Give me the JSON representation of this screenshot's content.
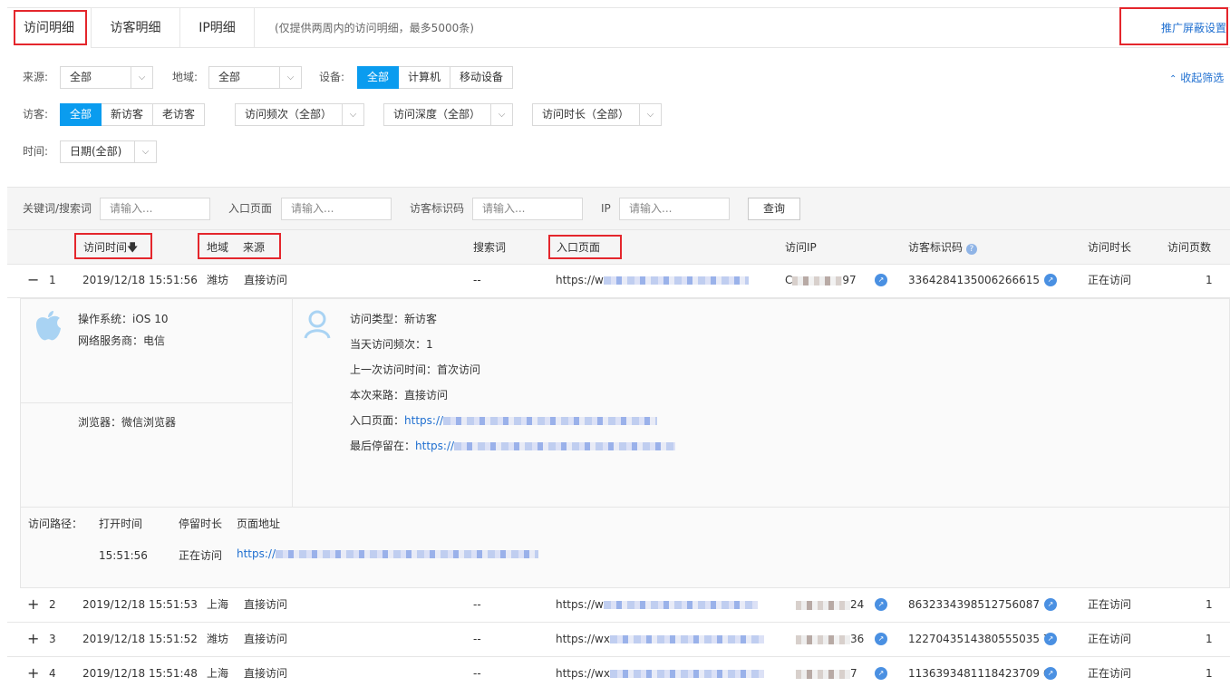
{
  "tabs": [
    {
      "label": "访问明细"
    },
    {
      "label": "访客明细"
    },
    {
      "label": "IP明细"
    }
  ],
  "tab_hint": "(仅提供两周内的访问明细，最多5000条)",
  "promo_link": "推广屏蔽设置",
  "collapse_filter": "收起筛选",
  "filters": {
    "source_label": "来源:",
    "source_value": "全部",
    "region_label": "地域:",
    "region_value": "全部",
    "device_label": "设备:",
    "device_options": [
      "全部",
      "计算机",
      "移动设备"
    ],
    "visitor_label": "访客:",
    "visitor_options": [
      "全部",
      "新访客",
      "老访客"
    ],
    "freq_value": "访问频次（全部）",
    "depth_value": "访问深度（全部）",
    "duration_value": "访问时长（全部）",
    "time_label": "时间:",
    "time_value": "日期(全部)"
  },
  "search": {
    "keyword_label": "关键词/搜索词",
    "entry_label": "入口页面",
    "visitor_id_label": "访客标识码",
    "ip_label": "IP",
    "placeholder": "请输入...",
    "query_button": "查询"
  },
  "columns": {
    "visit_time": "访问时间",
    "region": "地域",
    "source": "来源",
    "search_word": "搜索词",
    "entry_page": "入口页面",
    "visitor_ip": "访问IP",
    "visitor_id": "访客标识码",
    "duration": "访问时长",
    "pages": "访问页数"
  },
  "rows": [
    {
      "toggle": "−",
      "index": "1",
      "time": "2019/12/18 15:51:56",
      "region": "潍坊",
      "source": "直接访问",
      "search": "--",
      "entry": "https://w",
      "ip_tail": "97",
      "ip_head": "C",
      "vid": "3364284135006266615",
      "duration": "正在访问",
      "pages": "1"
    },
    {
      "toggle": "+",
      "index": "2",
      "time": "2019/12/18 15:51:53",
      "region": "上海",
      "source": "直接访问",
      "search": "--",
      "entry": "https://w",
      "ip_tail": "24",
      "ip_head": "",
      "vid": "8632334398512756087",
      "duration": "正在访问",
      "pages": "1"
    },
    {
      "toggle": "+",
      "index": "3",
      "time": "2019/12/18 15:51:52",
      "region": "潍坊",
      "source": "直接访问",
      "search": "--",
      "entry": "https://wx",
      "ip_tail": "36",
      "ip_head": "",
      "vid": "1227043514380555035 7",
      "duration": "正在访问",
      "pages": "1"
    },
    {
      "toggle": "+",
      "index": "4",
      "time": "2019/12/18 15:51:48",
      "region": "上海",
      "source": "直接访问",
      "search": "--",
      "entry": "https://wx",
      "ip_tail": "7",
      "ip_head": "",
      "vid": "1136393481118423709 6",
      "duration": "正在访问",
      "pages": "1"
    }
  ],
  "detail": {
    "os": "操作系统：iOS 10",
    "isp": "网络服务商：电信",
    "browser": "浏览器：微信浏览器",
    "visit_type": "访问类型：新访客",
    "day_freq": "当天访问频次：1",
    "last_visit": "上一次访问时间：首次访问",
    "this_source": "本次来路：直接访问",
    "entry_page_label": "入口页面：",
    "entry_page_url": "https://",
    "last_stay_label": "最后停留在：",
    "last_stay_url": "https://",
    "path_label": "访问路径：",
    "path_cols": [
      "打开时间",
      "停留时长",
      "页面地址"
    ],
    "path_open_time": "15:51:56",
    "path_stay": "正在访问",
    "path_url": "https://"
  },
  "colors": {
    "accent": "#0a9cef",
    "link": "#1f6fd0",
    "highlight": "#e4262c"
  }
}
